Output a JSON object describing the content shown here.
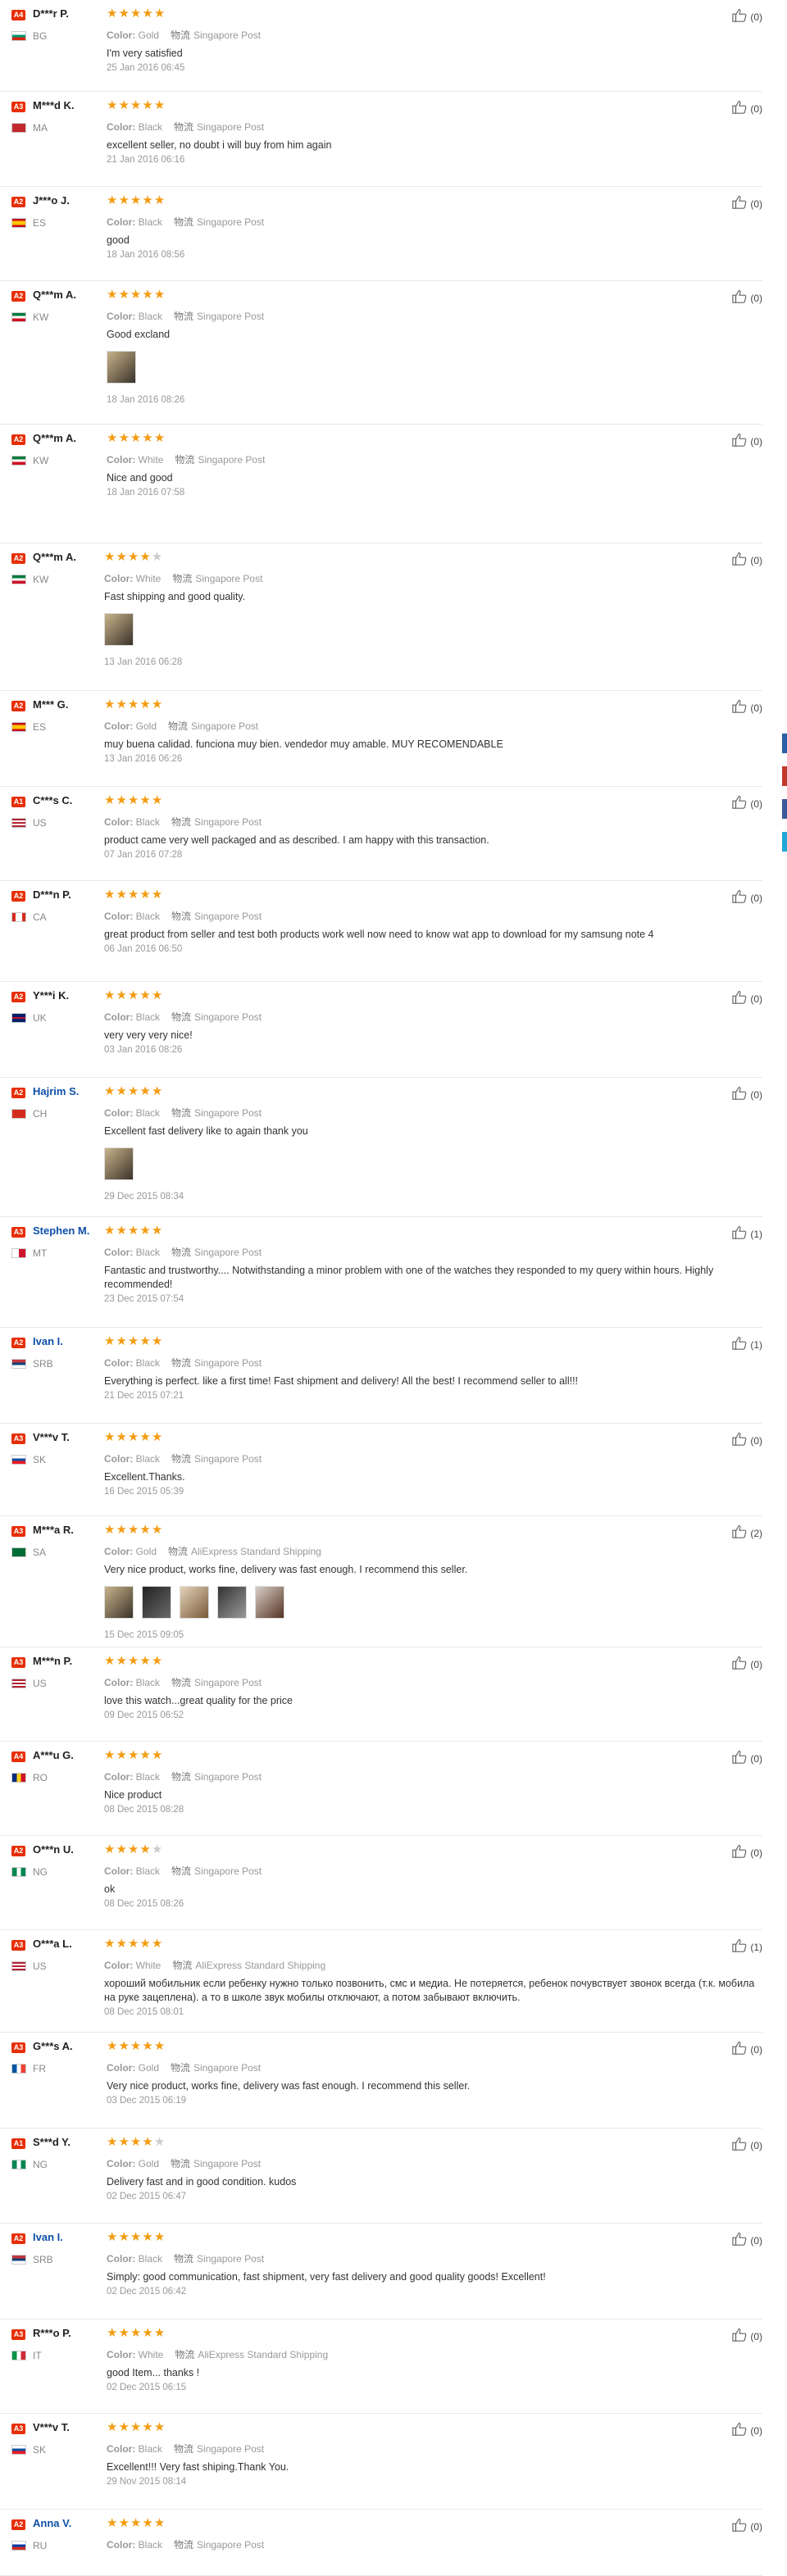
{
  "labels": {
    "color": "Color:",
    "ship_icon": "物流"
  },
  "colors": {
    "star": "#f39c12",
    "level_badge": "#e62e04",
    "link_name": "#0f4fa8"
  },
  "reviews": [
    {
      "level": "A4",
      "name": "D***r P.",
      "link": false,
      "flag": "bg",
      "country": "BG",
      "stars": 5,
      "color": "Gold",
      "shipping": "Singapore Post",
      "text": "I'm very satisfied",
      "photos": 0,
      "date": "25 Jan 2016 06:45",
      "helpful": "(0)"
    },
    {
      "level": "A3",
      "name": "M***d K.",
      "link": false,
      "flag": "ma",
      "country": "MA",
      "stars": 5,
      "color": "Black",
      "shipping": "Singapore Post",
      "text": "excellent seller, no doubt i will buy from him again",
      "photos": 0,
      "date": "21 Jan 2016 06:16",
      "helpful": "(0)"
    },
    {
      "level": "A2",
      "name": "J***o J.",
      "link": false,
      "flag": "es",
      "country": "ES",
      "stars": 5,
      "color": "Black",
      "shipping": "Singapore Post",
      "text": "good",
      "photos": 0,
      "date": "18 Jan 2016 08:56",
      "helpful": "(0)"
    },
    {
      "level": "A2",
      "name": "Q***m A.",
      "link": false,
      "flag": "kw",
      "country": "KW",
      "stars": 5,
      "color": "Black",
      "shipping": "Singapore Post",
      "text": "Good excland",
      "photos": 1,
      "date": "18 Jan 2016 08:26",
      "helpful": "(0)"
    },
    {
      "level": "A2",
      "name": "Q***m A.",
      "link": false,
      "flag": "kw",
      "country": "KW",
      "stars": 5,
      "color": "White",
      "shipping": "Singapore Post",
      "text": "Nice and good",
      "photos": 0,
      "date": "18 Jan 2016 07:58",
      "helpful": "(0)"
    },
    {
      "level": "A2",
      "name": "Q***m A.",
      "link": false,
      "flag": "kw",
      "country": "KW",
      "stars": 4,
      "color": "White",
      "shipping": "Singapore Post",
      "text": "Fast shipping and good quality.",
      "photos": 1,
      "date": "13 Jan 2016 06:28",
      "helpful": "(0)"
    },
    {
      "level": "A2",
      "name": "M*** G.",
      "link": false,
      "flag": "es",
      "country": "ES",
      "stars": 5,
      "color": "Gold",
      "shipping": "Singapore Post",
      "text": "muy buena calidad. funciona muy bien. vendedor muy amable. MUY RECOMENDABLE",
      "photos": 0,
      "date": "13 Jan 2016 06:26",
      "helpful": "(0)"
    },
    {
      "level": "A1",
      "name": "C***s C.",
      "link": false,
      "flag": "us",
      "country": "US",
      "stars": 5,
      "color": "Black",
      "shipping": "Singapore Post",
      "text": "product came very well packaged and as described. I am happy with this transaction.",
      "photos": 0,
      "date": "07 Jan 2016 07:28",
      "helpful": "(0)"
    },
    {
      "level": "A2",
      "name": "D***n P.",
      "link": false,
      "flag": "ca",
      "country": "CA",
      "stars": 5,
      "color": "Black",
      "shipping": "Singapore Post",
      "text": "great product from seller and test both products work well now need to know wat app to download for my samsung note 4",
      "photos": 0,
      "date": "06 Jan 2016 06:50",
      "helpful": "(0)"
    },
    {
      "level": "A2",
      "name": "Y***i K.",
      "link": false,
      "flag": "uk",
      "country": "UK",
      "stars": 5,
      "color": "Black",
      "shipping": "Singapore Post",
      "text": "very very very nice!",
      "photos": 0,
      "date": "03 Jan 2016 08:26",
      "helpful": "(0)"
    },
    {
      "level": "A2",
      "name": "Hajrim S.",
      "link": true,
      "flag": "ch",
      "country": "CH",
      "stars": 5,
      "color": "Black",
      "shipping": "Singapore Post",
      "text": "Excellent fast delivery like to again thank you",
      "photos": 1,
      "date": "29 Dec 2015 08:34",
      "helpful": "(0)"
    },
    {
      "level": "A3",
      "name": "Stephen M.",
      "link": true,
      "flag": "mt",
      "country": "MT",
      "stars": 5,
      "color": "Black",
      "shipping": "Singapore Post",
      "text": "Fantastic and trustworthy.... Notwithstanding a minor problem with one of the watches they responded to my query within hours. Highly recommended!",
      "photos": 0,
      "date": "23 Dec 2015 07:54",
      "helpful": "(1)"
    },
    {
      "level": "A2",
      "name": "Ivan I.",
      "link": true,
      "flag": "srb",
      "country": "SRB",
      "stars": 5,
      "color": "Black",
      "shipping": "Singapore Post",
      "text": "Everything is perfect. like a first time! Fast shipment and delivery! All the best! I recommend seller to all!!!",
      "photos": 0,
      "date": "21 Dec 2015 07:21",
      "helpful": "(1)"
    },
    {
      "level": "A3",
      "name": "V***v T.",
      "link": false,
      "flag": "sk",
      "country": "SK",
      "stars": 5,
      "color": "Black",
      "shipping": "Singapore Post",
      "text": "Excellent.Thanks.",
      "photos": 0,
      "date": "16 Dec 2015 05:39",
      "helpful": "(0)"
    },
    {
      "level": "A3",
      "name": "M***a R.",
      "link": false,
      "flag": "sa",
      "country": "SA",
      "stars": 5,
      "color": "Gold",
      "shipping": "AliExpress Standard Shipping",
      "text": "Very nice product, works fine, delivery was fast enough. I recommend this seller.",
      "photos": 5,
      "date": "15 Dec 2015 09:05",
      "helpful": "(2)"
    },
    {
      "level": "A3",
      "name": "M***n P.",
      "link": false,
      "flag": "us",
      "country": "US",
      "stars": 5,
      "color": "Black",
      "shipping": "Singapore Post",
      "text": "love this watch...great quality for the price",
      "photos": 0,
      "date": "09 Dec 2015 06:52",
      "helpful": "(0)"
    },
    {
      "level": "A4",
      "name": "A***u G.",
      "link": false,
      "flag": "ro",
      "country": "RO",
      "stars": 5,
      "color": "Black",
      "shipping": "Singapore Post",
      "text": "Nice product",
      "photos": 0,
      "date": "08 Dec 2015 08:28",
      "helpful": "(0)"
    },
    {
      "level": "A2",
      "name": "O***n U.",
      "link": false,
      "flag": "ng",
      "country": "NG",
      "stars": 4,
      "color": "Black",
      "shipping": "Singapore Post",
      "text": "ok",
      "photos": 0,
      "date": "08 Dec 2015 08:26",
      "helpful": "(0)"
    },
    {
      "level": "A3",
      "name": "O***a L.",
      "link": false,
      "flag": "us",
      "country": "US",
      "stars": 5,
      "color": "White",
      "shipping": "AliExpress Standard Shipping",
      "text": "хороший мобильник если ребенку нужно только позвонить, смс и медиа. Не потеряется, ребенок почувствует звонок всегда (т.к. мобила на руке зацеплена). а то в школе звук мобилы отключают, а потом забывают включить.",
      "photos": 0,
      "date": "08 Dec 2015 08:01",
      "helpful": "(1)"
    },
    {
      "level": "A3",
      "name": "G***s A.",
      "link": false,
      "flag": "fr",
      "country": "FR",
      "stars": 5,
      "color": "Gold",
      "shipping": "Singapore Post",
      "text": "Very nice product, works fine, delivery was fast enough. I recommend this seller.",
      "photos": 0,
      "date": "03 Dec 2015 06:19",
      "helpful": "(0)"
    },
    {
      "level": "A1",
      "name": "S***d Y.",
      "link": false,
      "flag": "ng",
      "country": "NG",
      "stars": 4,
      "color": "Gold",
      "shipping": "Singapore Post",
      "text": "Delivery fast and in good condition. kudos",
      "photos": 0,
      "date": "02 Dec 2015 06:47",
      "helpful": "(0)"
    },
    {
      "level": "A2",
      "name": "Ivan I.",
      "link": true,
      "flag": "srb",
      "country": "SRB",
      "stars": 5,
      "color": "Black",
      "shipping": "Singapore Post",
      "text": "Simply: good communication, fast shipment, very fast delivery and good quality goods! Excellent!",
      "photos": 0,
      "date": "02 Dec 2015 06:42",
      "helpful": "(0)"
    },
    {
      "level": "A3",
      "name": "R***o P.",
      "link": false,
      "flag": "it",
      "country": "IT",
      "stars": 5,
      "color": "White",
      "shipping": "AliExpress Standard Shipping",
      "text": "good Item... thanks !",
      "photos": 0,
      "date": "02 Dec 2015 06:15",
      "helpful": "(0)"
    },
    {
      "level": "A3",
      "name": "V***v T.",
      "link": false,
      "flag": "sk",
      "country": "SK",
      "stars": 5,
      "color": "Black",
      "shipping": "Singapore Post",
      "text": "Excellent!!! Very fast shiping.Thank You.",
      "photos": 0,
      "date": "29 Nov 2015 08:14",
      "helpful": "(0)"
    },
    {
      "level": "A2",
      "name": "Anna V.",
      "link": true,
      "flag": "ru",
      "country": "RU",
      "stars": 5,
      "color": "Black",
      "shipping": "Singapore Post",
      "text": "",
      "photos": 0,
      "date": "",
      "helpful": "(0)"
    }
  ]
}
